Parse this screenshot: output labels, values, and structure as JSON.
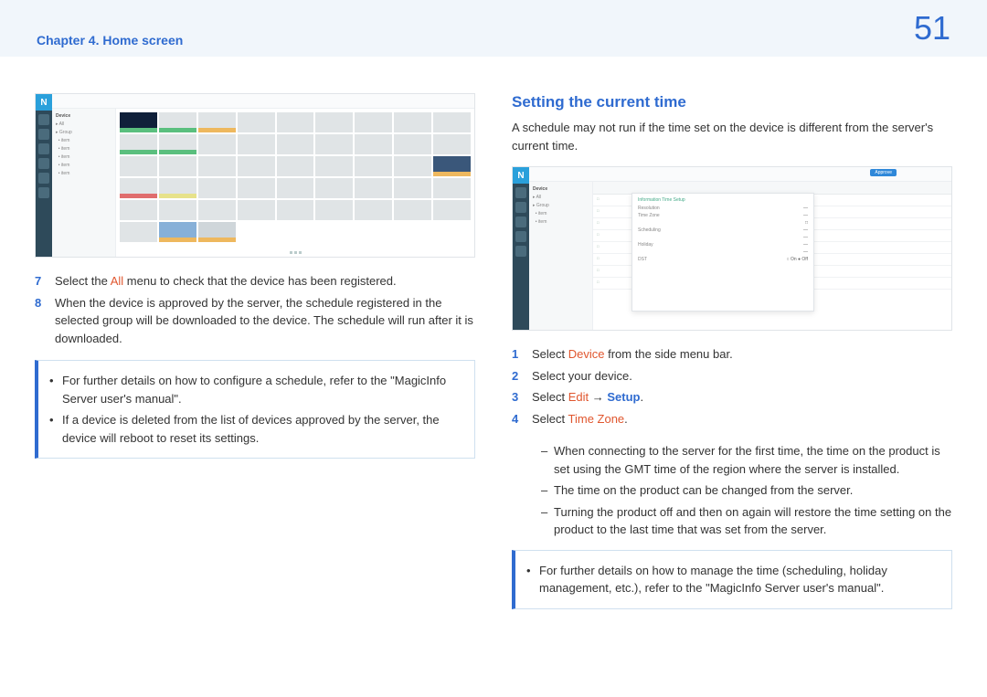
{
  "header": {
    "chapter": "Chapter 4. Home screen",
    "page_number": "51"
  },
  "left_steps": [
    {
      "n": "7",
      "pre": "Select the ",
      "accent": "All",
      "post": " menu to check that the device has been registered."
    },
    {
      "n": "8",
      "text": "When the device is approved by the server, the schedule registered in the selected group will be downloaded to the device. The schedule will run after it is downloaded."
    }
  ],
  "left_note": [
    "For further details on how to configure a schedule, refer to the \"MagicInfo Server user's manual\".",
    "If a device is deleted from the list of devices approved by the server, the device will reboot to reset its settings."
  ],
  "right_title": "Setting the current time",
  "right_para": "A schedule may not run if the time set on the device is different from the server's current time.",
  "right_steps": {
    "s1_pre": "Select ",
    "s1_accent": "Device",
    "s1_post": " from the side menu bar.",
    "s2": "Select your device.",
    "s3_pre": "Select ",
    "s3_a": "Edit",
    "s3_arrow": " → ",
    "s3_b": "Setup",
    "s3_post": ".",
    "s4_pre": "Select ",
    "s4_accent": "Time Zone",
    "s4_post": "."
  },
  "right_dashes": [
    "When connecting to the server for the first time, the time on the product is set using the GMT time of the region where the server is installed.",
    "The time on the product can be changed from the server.",
    "Turning the product off and then on again will restore the time setting on the product to the last time that was set from the server."
  ],
  "right_note": "For further details on how to manage the time (scheduling, holiday management, etc.), refer to the \"MagicInfo Server user's manual\".",
  "mock_labels": {
    "sidebar_heading": "Device",
    "panel_tabs": "Information   Time   Setup",
    "panel_title": "Time Zone",
    "approve_btn": "Approve"
  }
}
